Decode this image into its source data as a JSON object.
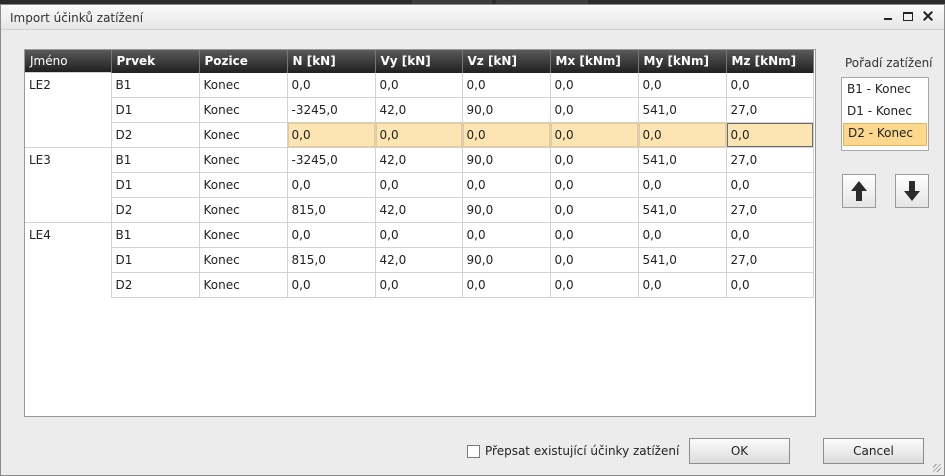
{
  "window": {
    "title": "Import účinků zatížení"
  },
  "grid": {
    "columns": [
      "Jméno",
      "Prvek",
      "Pozice",
      "N [kN]",
      "Vy [kN]",
      "Vz [kN]",
      "Mx [kNm]",
      "My [kNm]",
      "Mz [kNm]"
    ],
    "rows": [
      {
        "name": "LE2",
        "prvek": "B1",
        "pozice": "Konec",
        "vals": [
          "0,0",
          "0,0",
          "0,0",
          "0,0",
          "0,0",
          "0,0"
        ]
      },
      {
        "name": "",
        "prvek": "D1",
        "pozice": "Konec",
        "vals": [
          "-3245,0",
          "42,0",
          "90,0",
          "0,0",
          "541,0",
          "27,0"
        ]
      },
      {
        "name": "",
        "prvek": "D2",
        "pozice": "Konec",
        "vals": [
          "0,0",
          "0,0",
          "0,0",
          "0,0",
          "0,0",
          "0,0"
        ],
        "selected": true
      },
      {
        "name": "LE3",
        "prvek": "B1",
        "pozice": "Konec",
        "vals": [
          "-3245,0",
          "42,0",
          "90,0",
          "0,0",
          "541,0",
          "27,0"
        ]
      },
      {
        "name": "",
        "prvek": "D1",
        "pozice": "Konec",
        "vals": [
          "0,0",
          "0,0",
          "0,0",
          "0,0",
          "0,0",
          "0,0"
        ]
      },
      {
        "name": "",
        "prvek": "D2",
        "pozice": "Konec",
        "vals": [
          "815,0",
          "42,0",
          "90,0",
          "0,0",
          "541,0",
          "27,0"
        ]
      },
      {
        "name": "LE4",
        "prvek": "B1",
        "pozice": "Konec",
        "vals": [
          "0,0",
          "0,0",
          "0,0",
          "0,0",
          "0,0",
          "0,0"
        ]
      },
      {
        "name": "",
        "prvek": "D1",
        "pozice": "Konec",
        "vals": [
          "815,0",
          "42,0",
          "90,0",
          "0,0",
          "541,0",
          "27,0"
        ]
      },
      {
        "name": "",
        "prvek": "D2",
        "pozice": "Konec",
        "vals": [
          "0,0",
          "0,0",
          "0,0",
          "0,0",
          "0,0",
          "0,0"
        ]
      }
    ]
  },
  "order_panel": {
    "label": "Pořadí zatížení",
    "items": [
      "B1 - Konec",
      "D1 - Konec",
      "D2 - Konec"
    ],
    "selected_index": 2
  },
  "icons": {
    "up": "arrow-up-icon",
    "down": "arrow-down-icon"
  },
  "footer": {
    "overwrite_label": "Přepsat existující účinky zatížení",
    "overwrite_checked": false,
    "ok_label": "OK",
    "cancel_label": "Cancel"
  },
  "colors": {
    "header_bg": "#2a2a2a",
    "selection": "#fce4b3",
    "list_selection": "#fcd88f"
  }
}
